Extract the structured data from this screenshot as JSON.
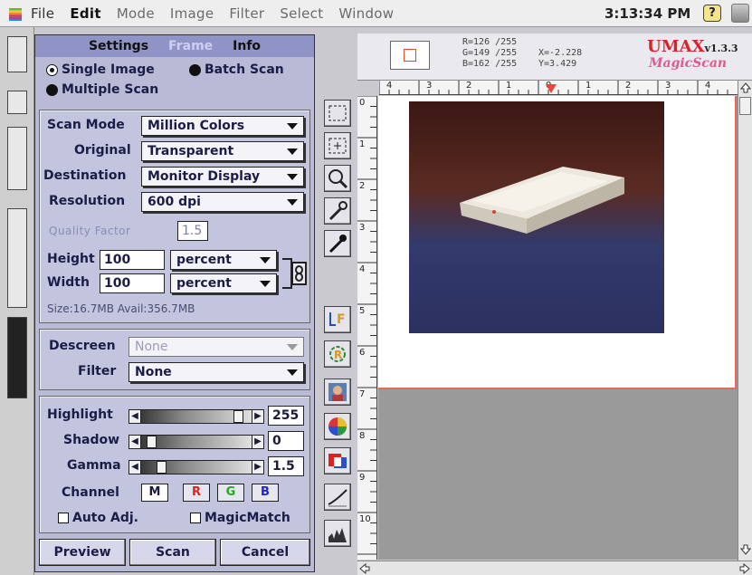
{
  "menubar": {
    "items": [
      "File",
      "Edit",
      "Mode",
      "Image",
      "Filter",
      "Select",
      "Window"
    ],
    "active_index": 1,
    "clock": "3:13:34 PM",
    "help": "?"
  },
  "settings": {
    "tabs": [
      "Settings",
      "Frame",
      "Info"
    ],
    "scan_type": {
      "single": "Single Image",
      "batch": "Batch Scan",
      "multiple": "Multiple Scan",
      "selected": "single"
    },
    "scan_mode": {
      "label": "Scan Mode",
      "value": "Million Colors"
    },
    "original": {
      "label": "Original",
      "value": "Transparent"
    },
    "destination": {
      "label": "Destination",
      "value": "Monitor Display"
    },
    "resolution": {
      "label": "Resolution",
      "value": "600 dpi"
    },
    "quality_factor": {
      "label": "Quality Factor",
      "value": "1.5"
    },
    "height": {
      "label": "Height",
      "value": "100",
      "unit": "percent"
    },
    "width": {
      "label": "Width",
      "value": "100",
      "unit": "percent"
    },
    "size_text": "Size:16.7MB  Avail:356.7MB",
    "descreen": {
      "label": "Descreen",
      "value": "None"
    },
    "filter": {
      "label": "Filter",
      "value": "None"
    },
    "highlight": {
      "label": "Highlight",
      "value": "255",
      "level": 0.92
    },
    "shadow": {
      "label": "Shadow",
      "value": "0",
      "level": 0.05
    },
    "gamma": {
      "label": "Gamma",
      "value": "1.5",
      "level": 0.15
    },
    "channel": {
      "label": "Channel",
      "buttons": [
        "M",
        "R",
        "G",
        "B"
      ]
    },
    "auto_adj": "Auto Adj.",
    "magic_match": "MagicMatch",
    "buttons": {
      "preview": "Preview",
      "scan": "Scan",
      "cancel": "Cancel"
    }
  },
  "info": {
    "rgb": [
      "R=126  /255",
      "G=149  /255",
      "B=162  /255"
    ],
    "xy": [
      "X=-2.228",
      "Y=3.429"
    ],
    "logo_top": "UMAX",
    "logo_version": "v1.3.3",
    "logo_bottom": "MagicScan"
  },
  "ruler": {
    "h_labels": [
      "4",
      "3",
      "2",
      "1",
      "0",
      "1",
      "2",
      "3",
      "4"
    ],
    "v_labels": [
      "0",
      "1",
      "2",
      "3",
      "4",
      "5",
      "6",
      "7",
      "8",
      "9",
      "10"
    ]
  },
  "colors": {
    "accent": "#8f93c6",
    "panel": "#b9bad6",
    "marker": "#e5483a"
  }
}
